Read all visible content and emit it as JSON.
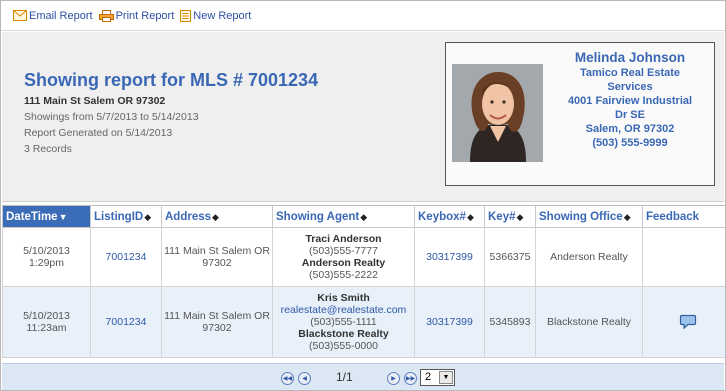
{
  "toolbar": {
    "email_label": "Email Report",
    "print_label": "Print Report",
    "new_label": "New Report"
  },
  "report": {
    "title": "Showing report for MLS # 7001234",
    "address": "111 Main St Salem OR 97302",
    "range": "Showings from 5/7/2013 to 5/14/2013",
    "generated": "Report Generated on 5/14/2013",
    "records": "3 Records"
  },
  "agent": {
    "name": "Melinda Johnson",
    "company_line1": "Tamico Real Estate",
    "company_line2": "Services",
    "street_line1": "4001 Fairview Industrial",
    "street_line2": "Dr SE",
    "city": "Salem, OR 97302",
    "phone": "(503) 555-9999"
  },
  "table": {
    "columns": {
      "datetime": "DateTime",
      "listing_id": "ListingID",
      "address": "Address",
      "showing_agent": "Showing Agent",
      "keybox": "Keybox#",
      "key": "Key#",
      "office": "Showing Office",
      "feedback": "Feedback"
    },
    "rows": [
      {
        "date": "5/10/2013",
        "time": "1:29pm",
        "listing_id": "7001234",
        "address": "111 Main St Salem OR 97302",
        "agent_name": "Traci Anderson",
        "agent_phone": "(503)555-7777",
        "agent_office": "Anderson Realty",
        "office_phone": "(503)555-2222",
        "keybox": "30317399",
        "key": "5366375",
        "office": "Anderson Realty"
      },
      {
        "date": "5/10/2013",
        "time": "11:23am",
        "listing_id": "7001234",
        "address": "111 Main St Salem OR 97302",
        "agent_name": "Kris Smith",
        "agent_email": "realestate@realestate.com",
        "agent_phone": "(503)555-1111",
        "agent_office": "Blackstone Realty",
        "office_phone": "(503)555-0000",
        "keybox": "30317399",
        "key": "5345893",
        "office": "Blackstone Realty"
      }
    ]
  },
  "pager": {
    "page_text": "1/1",
    "page_size": "2"
  }
}
